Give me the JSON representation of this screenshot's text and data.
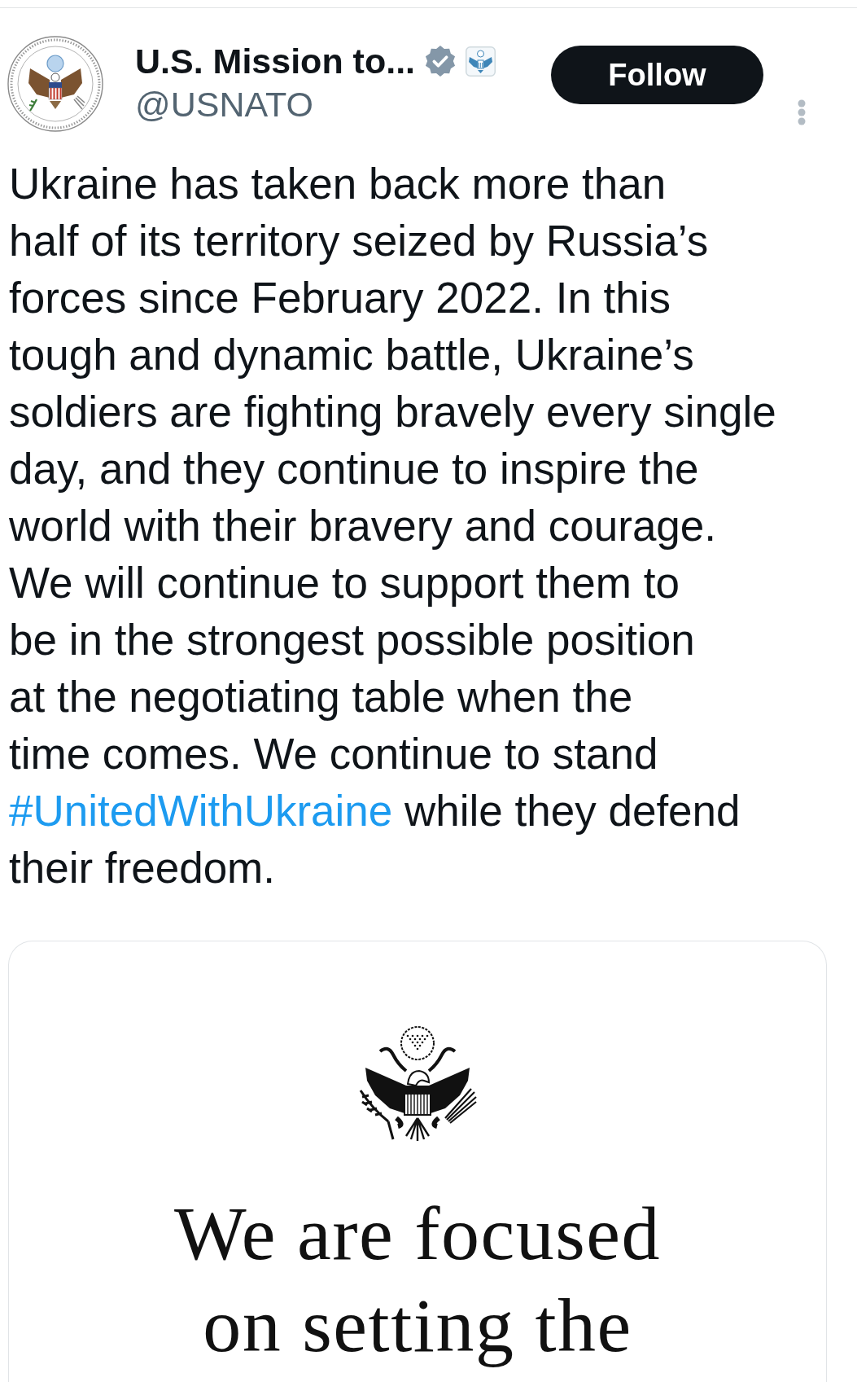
{
  "header": {
    "display_name": "U.S. Mission to...",
    "verified": true,
    "handle": "@USNATO",
    "follow_button": {
      "label": "Follow"
    }
  },
  "post": {
    "segments": [
      {
        "kind": "text",
        "text": "Ukraine has taken back more than\nhalf of its territory seized by Russia’s\nforces since February 2022. In this\ntough and dynamic battle, Ukraine’s\nsoldiers are fighting bravely every single\nday, and they continue to inspire the\nworld with their bravery and courage.\nWe will continue to support them to\nbe in the strongest possible position\nat the negotiating table when the\ntime comes. We continue to stand\n"
      },
      {
        "kind": "hashtag",
        "text": "#UnitedWithUkraine"
      },
      {
        "kind": "text",
        "text": " while they defend\ntheir freedom."
      }
    ]
  },
  "media": {
    "text": "We are focused on setting the"
  }
}
